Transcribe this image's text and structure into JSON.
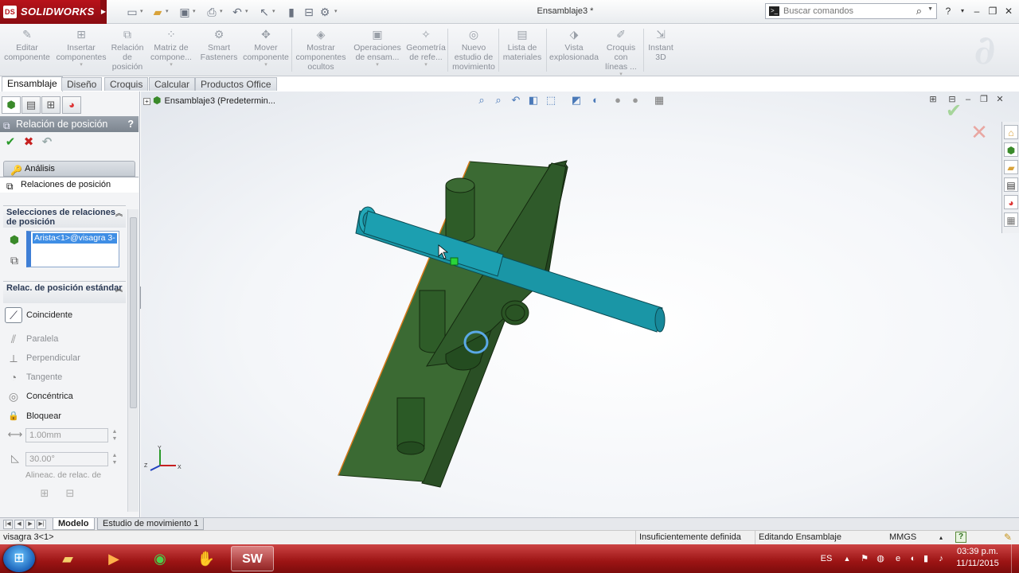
{
  "app": {
    "logo_text": "SOLIDWORKS",
    "logo_mark": "DS",
    "document_title": "Ensamblaje3 *"
  },
  "search": {
    "placeholder": "Buscar comandos"
  },
  "commands": [
    {
      "label": "Editar\ncomponente",
      "icon": "edit-component-icon",
      "glyph": "✎"
    },
    {
      "label": "Insertar\ncomponentes",
      "icon": "insert-components-icon",
      "glyph": "⊞",
      "dropdown": true
    },
    {
      "label": "Relación\nde\nposición",
      "icon": "mate-icon",
      "glyph": "⧉"
    },
    {
      "label": "Matriz de\ncompone...",
      "icon": "pattern-icon",
      "glyph": "⁘",
      "dropdown": true
    },
    {
      "label": "Smart\nFasteners",
      "icon": "smart-fasteners-icon",
      "glyph": "⚙"
    },
    {
      "label": "Mover\ncomponente",
      "icon": "move-component-icon",
      "glyph": "✥",
      "dropdown": true
    },
    {
      "label": "Mostrar\ncomponentes\nocultos",
      "icon": "show-hidden-icon",
      "glyph": "◈"
    },
    {
      "label": "Operaciones\nde ensam...",
      "icon": "assembly-features-icon",
      "glyph": "▣",
      "dropdown": true
    },
    {
      "label": "Geometría\nde refe...",
      "icon": "reference-geometry-icon",
      "glyph": "✧",
      "dropdown": true
    },
    {
      "label": "Nuevo\nestudio de\nmovimiento",
      "icon": "motion-study-icon",
      "glyph": "◎"
    },
    {
      "label": "Lista de\nmateriales",
      "icon": "bom-icon",
      "glyph": "▤"
    },
    {
      "label": "Vista\nexplosionada",
      "icon": "exploded-view-icon",
      "glyph": "⬗"
    },
    {
      "label": "Croquis\ncon\nlíneas ...",
      "icon": "explode-line-sketch-icon",
      "glyph": "✐",
      "dropdown": true
    },
    {
      "label": "Instant\n3D",
      "icon": "instant3d-icon",
      "glyph": "⇲"
    }
  ],
  "tabs": [
    "Ensamblaje",
    "Diseño",
    "Croquis",
    "Calcular",
    "Productos Office"
  ],
  "property_manager": {
    "title": "Relación de posición",
    "help": "?",
    "tab_analysis": "Análisis",
    "tab_mates": "Relaciones de posición",
    "selections_header": "Selecciones de relaciones de posición",
    "selection_item": "Arista<1>@visagra 3-",
    "standard_header": "Relac. de posición estándar",
    "mates": [
      {
        "label": "Coincidente",
        "icon": "coincident-icon",
        "glyph": "⟋",
        "selected": true,
        "enabled": true
      },
      {
        "label": "Paralela",
        "icon": "parallel-icon",
        "glyph": "⫽",
        "selected": false,
        "enabled": false
      },
      {
        "label": "Perpendicular",
        "icon": "perpendicular-icon",
        "glyph": "⟂",
        "selected": false,
        "enabled": false
      },
      {
        "label": "Tangente",
        "icon": "tangent-icon",
        "glyph": "◔",
        "selected": false,
        "enabled": false
      },
      {
        "label": "Concéntrica",
        "icon": "concentric-icon",
        "glyph": "◎",
        "selected": false,
        "enabled": true
      },
      {
        "label": "Bloquear",
        "icon": "lock-icon",
        "glyph": "🔒",
        "selected": false,
        "enabled": true
      }
    ],
    "distance_value": "1.00mm",
    "angle_value": "30.00°",
    "alignment_label": "Alineac. de relac. de"
  },
  "feature_tree": {
    "node_label": "Ensamblaje3  (Predetermin..."
  },
  "bottom_tabs": [
    "Modelo",
    "Estudio de movimiento 1"
  ],
  "status": {
    "selection": "visagra 3<1>",
    "definition": "Insuficientemente definida",
    "mode": "Editando Ensamblaje",
    "units": "MMGS"
  },
  "taskbar": {
    "language": "ES",
    "time": "03:39 p.m.",
    "date": "11/11/2015"
  },
  "colors": {
    "plate_green": "#2f5a2a",
    "shaft_teal": "#1a96a6",
    "brand_red": "#b8121a",
    "taskbar_red": "#9c1414"
  }
}
